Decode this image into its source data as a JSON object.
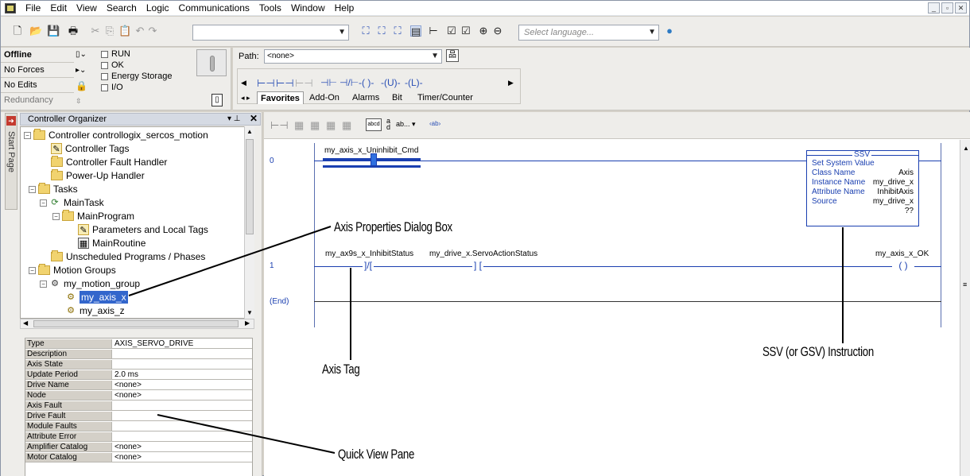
{
  "menu": [
    "File",
    "Edit",
    "View",
    "Search",
    "Logic",
    "Communications",
    "Tools",
    "Window",
    "Help"
  ],
  "window_controls": [
    "_",
    "▫",
    "✕"
  ],
  "toolbar": {
    "language_placeholder": "Select language..."
  },
  "status": {
    "mode": "Offline",
    "forces": "No Forces",
    "edits": "No Edits",
    "redundancy": "Redundancy",
    "checks": [
      "RUN",
      "OK",
      "Energy Storage",
      "I/O"
    ]
  },
  "path": {
    "label": "Path:",
    "value": "<none>"
  },
  "palette_tabs": [
    "Favorites",
    "Add-On",
    "Alarms",
    "Bit",
    "Timer/Counter"
  ],
  "start_page": "Start Page",
  "organizer": {
    "title": "Controller Organizer",
    "tree": [
      "Controller controllogix_sercos_motion",
      "Controller Tags",
      "Controller Fault Handler",
      "Power-Up Handler",
      "Tasks",
      "MainTask",
      "MainProgram",
      "Parameters and Local Tags",
      "MainRoutine",
      "Unscheduled Programs / Phases",
      "Motion Groups",
      "my_motion_group",
      "my_axis_x",
      "my_axis_z"
    ]
  },
  "quick_view": [
    [
      "Type",
      "AXIS_SERVO_DRIVE"
    ],
    [
      "Description",
      ""
    ],
    [
      "Axis State",
      ""
    ],
    [
      "Update Period",
      "2.0 ms"
    ],
    [
      "Drive Name",
      "<none>"
    ],
    [
      "Node",
      "<none>"
    ],
    [
      "Axis Fault",
      ""
    ],
    [
      "Drive Fault",
      ""
    ],
    [
      "Module Faults",
      ""
    ],
    [
      "Attribute Error",
      ""
    ],
    [
      "Amplifier Catalog",
      "<none>"
    ],
    [
      "Motor Catalog",
      "<none>"
    ]
  ],
  "ladder": {
    "rung0_num": "0",
    "rung1_num": "1",
    "end_label": "(End)",
    "rung0_tag": "my_axis_x_Uninhibit_Cmd",
    "rung1_tag_a": "my_ax9s_x_InhibitStatus",
    "rung1_tag_b": "my_drive_x.ServoActionStatus",
    "rung1_coil": "my_axis_x_OK",
    "coil_symbol": "( )",
    "ssv": {
      "title": "SSV",
      "name": "Set System Value",
      "rows": [
        [
          "Class Name",
          "Axis"
        ],
        [
          "Instance Name",
          "my_drive_x"
        ],
        [
          "Attribute Name",
          "InhibitAxis"
        ],
        [
          "Source",
          "my_drive_x"
        ],
        [
          "",
          "??"
        ]
      ]
    }
  },
  "callouts": {
    "axis_properties": "Axis Properties Dialog Box",
    "axis_tag": "Axis Tag",
    "ssv_instruction": "SSV (or GSV) Instruction",
    "quick_view": "Quick View Pane"
  }
}
